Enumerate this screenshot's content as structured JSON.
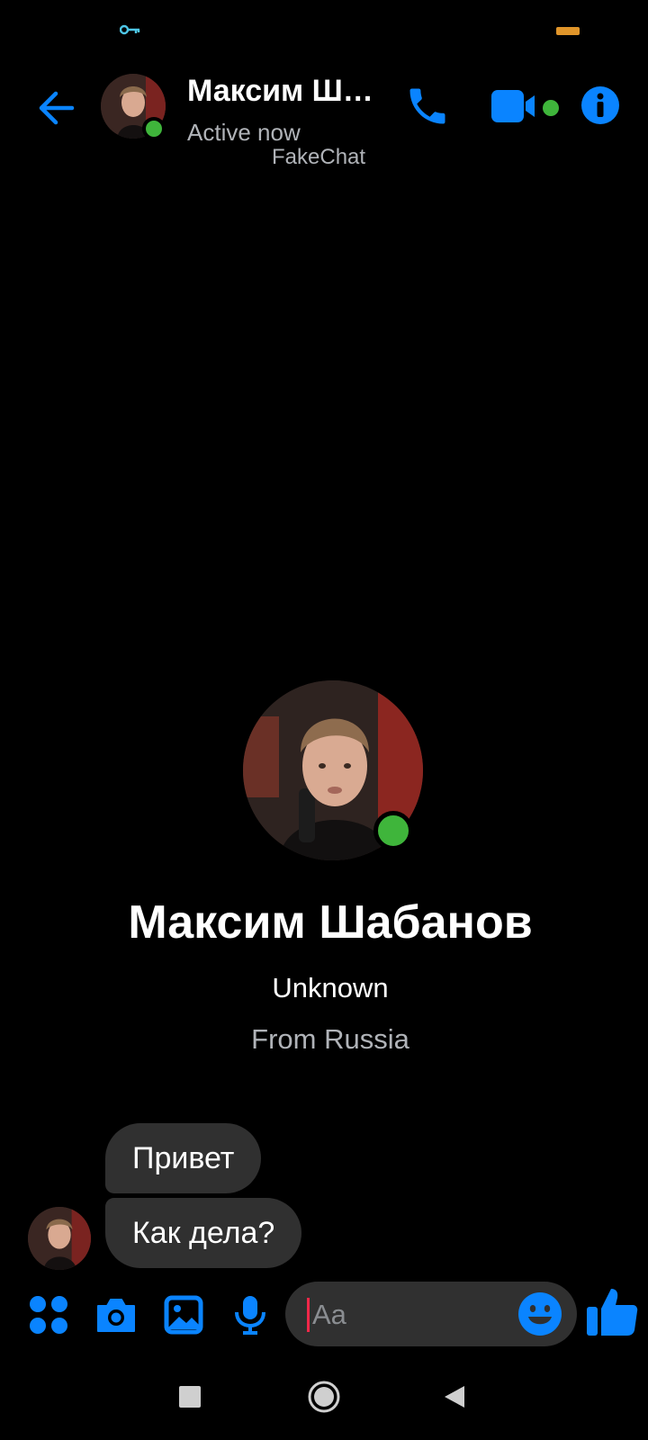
{
  "header": {
    "contact_name": "Максим Ша...",
    "active_status": "Active now",
    "watermark": "FakeChat"
  },
  "profile": {
    "name": "Максим Шабанов",
    "subtitle": "Unknown",
    "location": "From Russia"
  },
  "messages": [
    {
      "text": "Привет"
    },
    {
      "text": "Как дела?"
    }
  ],
  "composer": {
    "placeholder": "Aa"
  },
  "colors": {
    "accent": "#0a84ff",
    "online": "#3fb53b",
    "bubble": "#303030",
    "background": "#000000",
    "secondary_text": "#b0b3b8"
  },
  "icons": {
    "status_bar": [
      "key-icon",
      "battery-icon"
    ],
    "header": [
      "back-arrow-icon",
      "phone-icon",
      "video-camera-icon",
      "info-icon"
    ],
    "composer": [
      "apps-icon",
      "camera-icon",
      "image-icon",
      "microphone-icon",
      "emoji-icon",
      "thumbs-up-icon"
    ],
    "nav": [
      "recents-icon",
      "home-icon",
      "back-icon"
    ]
  }
}
